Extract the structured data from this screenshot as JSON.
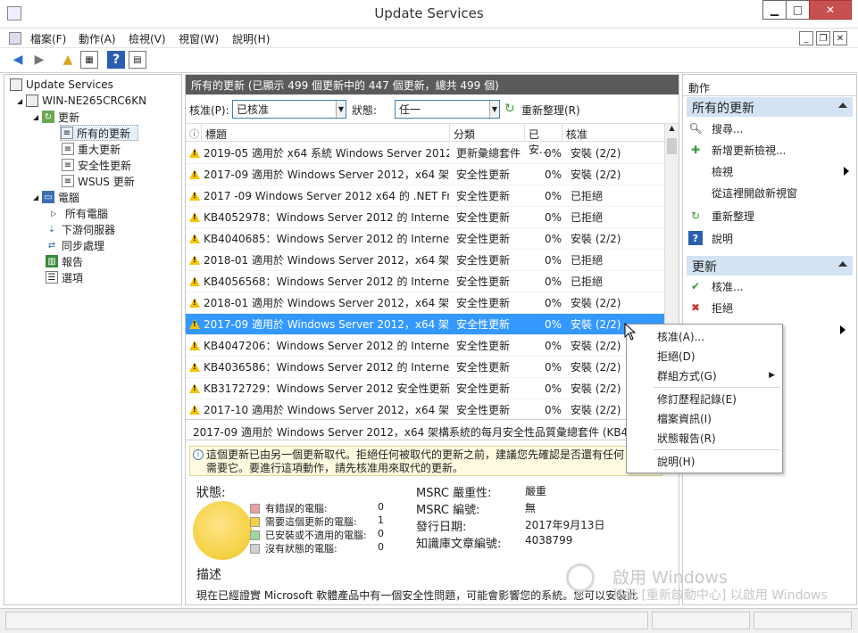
{
  "window": {
    "title": "Update Services",
    "min": "▁",
    "max": "□",
    "close": "✕"
  },
  "menubar": {
    "items": [
      "檔案(F)",
      "動作(A)",
      "檢視(V)",
      "視窗(W)",
      "說明(H)"
    ]
  },
  "tree": {
    "root": "Update Services",
    "server": "WIN-NE265CRC6KN",
    "updates": "更新",
    "all_updates": "所有的更新",
    "critical": "重大更新",
    "security": "安全性更新",
    "wsus": "WSUS 更新",
    "computers": "電腦",
    "all_computers": "所有電腦",
    "downstream": "下游伺服器",
    "sync": "同步處理",
    "reports": "報告",
    "options": "選項"
  },
  "center": {
    "header": "所有的更新   (已顯示 499 個更新中的 447 個更新，總共 499 個)",
    "approval_label": "核准(P):",
    "approval_value": "已核准",
    "status_label": "狀態:",
    "status_value": "任一",
    "refresh": "重新整理(R)",
    "columns": {
      "title": "標題",
      "classification": "分類",
      "installed": "已安...",
      "approval": "核准"
    },
    "rows": [
      {
        "title": "2019-05 適用於 x64 系統 Windows Server 2012 ...",
        "classification": "更新彙總套件",
        "installed": "0%",
        "approval": "安裝 (2/2)"
      },
      {
        "title": "2017-09 適用於 Windows Server 2012，x64 架...",
        "classification": "安全性更新",
        "installed": "0%",
        "approval": "安裝 (2/2)"
      },
      {
        "title": "2017 -09 Windows Server 2012 x64 的 .NET Fra...",
        "classification": "安全性更新",
        "installed": "0%",
        "approval": "已拒絕"
      },
      {
        "title": "KB4052978：Windows Server 2012 的 Internet ...",
        "classification": "安全性更新",
        "installed": "0%",
        "approval": "已拒絕"
      },
      {
        "title": "KB4040685：Windows Server 2012 的 Internet ...",
        "classification": "安全性更新",
        "installed": "0%",
        "approval": "安裝 (2/2)"
      },
      {
        "title": "2018-01 適用於 Windows Server 2012，x64 架...",
        "classification": "安全性更新",
        "installed": "0%",
        "approval": "已拒絕"
      },
      {
        "title": "KB4056568：Windows Server 2012 的 Internet ...",
        "classification": "安全性更新",
        "installed": "0%",
        "approval": "已拒絕"
      },
      {
        "title": "2018-01 適用於 Windows Server 2012，x64 架...",
        "classification": "安全性更新",
        "installed": "0%",
        "approval": "安裝 (2/2)"
      },
      {
        "title": "2017-09 適用於 Windows Server 2012，x64 架...",
        "classification": "安全性更新",
        "installed": "0%",
        "approval": "安裝 (2/2)"
      },
      {
        "title": "KB4047206：Windows Server 2012 的 Internet ...",
        "classification": "安全性更新",
        "installed": "0%",
        "approval": "安裝 (2/2)"
      },
      {
        "title": "KB4036586：Windows Server 2012 的 Internet ...",
        "classification": "安全性更新",
        "installed": "0%",
        "approval": "安裝 (2/2)"
      },
      {
        "title": "KB3172729：Windows Server 2012 安全性更新",
        "classification": "安全性更新",
        "installed": "0%",
        "approval": "安裝 (2/2)"
      },
      {
        "title": "2017-10 適用於 Windows Server 2012，x64 架...",
        "classification": "安全性更新",
        "installed": "0%",
        "approval": "安裝 (2/2)"
      }
    ],
    "selected_row": 8,
    "detail_title": "2017-09 適用於 Windows Server 2012，x64 架構系統的每月安全性品質彙總套件 (KB4038",
    "info_line1": "這個更新已由另一個更新取代。拒絕任何被取代的更新之前，建議您先確認是否還有任何",
    "info_line2": "需要它。要進行這項動作，請先核准用來取代的更新。",
    "legend": [
      {
        "label": "有錯誤的電腦:",
        "value": "0",
        "color": "#e8a0a0"
      },
      {
        "label": "需要這個更新的電腦:",
        "value": "1",
        "color": "#f3d03e"
      },
      {
        "label": "已安裝或不適用的電腦:",
        "value": "0",
        "color": "#9fd49f"
      },
      {
        "label": "沒有狀態的電腦:",
        "value": "0",
        "color": "#d0d0d0"
      }
    ],
    "props": [
      {
        "k": "MSRC 嚴重性:",
        "v": "嚴重"
      },
      {
        "k": "MSRC 編號:",
        "v": "無"
      },
      {
        "k": "發行日期:",
        "v": "2017年9月13日"
      },
      {
        "k": "知識庫文章編號:",
        "v": "4038799"
      }
    ],
    "desc_label": "描述",
    "desc_text": "現在已經證實 Microsoft 軟體產品中有一個安全性問題，可能會影響您的系統。您可以安裝此"
  },
  "actions": {
    "header": "動作",
    "sec1": "所有的更新",
    "search": "搜尋...",
    "new_view": "新增更新檢視...",
    "view": "檢視",
    "new_window": "從這裡開啟新視窗",
    "refresh": "重新整理",
    "help": "說明",
    "sec2": "更新",
    "approve": "核准...",
    "decline": "拒絕"
  },
  "context_menu": {
    "items": [
      "核准(A)...",
      "拒絕(D)",
      "群組方式(G)",
      "修訂歷程記錄(E)",
      "檔案資訊(I)",
      "狀態報告(R)",
      "說明(H)"
    ]
  },
  "watermark": {
    "line1": "啟用 Windows",
    "line2": "移至 [重新啟動中心] 以啟用 Windows"
  }
}
